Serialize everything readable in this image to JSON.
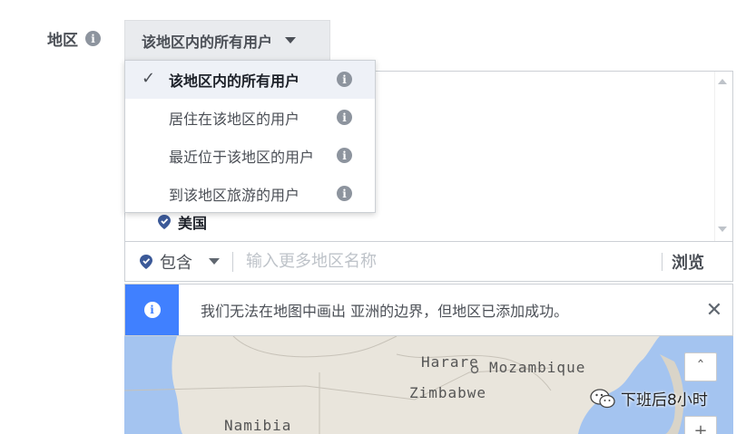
{
  "region": {
    "label": "地区"
  },
  "selector": {
    "value": "该地区内的所有用户"
  },
  "dropdown": {
    "items": [
      {
        "label": "该地区内的所有用户"
      },
      {
        "label": "居住在该地区的用户"
      },
      {
        "label": "最近位于该地区的用户"
      },
      {
        "label": "到该地区旅游的用户"
      }
    ]
  },
  "locations": [
    {
      "label": "美国"
    }
  ],
  "input_row": {
    "include_label": "包含",
    "placeholder": "输入更多地区名称",
    "browse_label": "浏览"
  },
  "notice": {
    "text": "我们无法在地图中画出 亚洲的边界，但地区已添加成功。"
  },
  "map": {
    "labels": {
      "harare": "Harare",
      "mozambique": "Mozambique",
      "zimbabwe": "Zimbabwe",
      "namibia": "Namibia"
    }
  },
  "watermark": {
    "text": "下班后8小时"
  },
  "colors": {
    "accent": "#4080ff",
    "pin": "#3b5998",
    "water": "#a4c4f0",
    "land": "#e9e5dc"
  }
}
